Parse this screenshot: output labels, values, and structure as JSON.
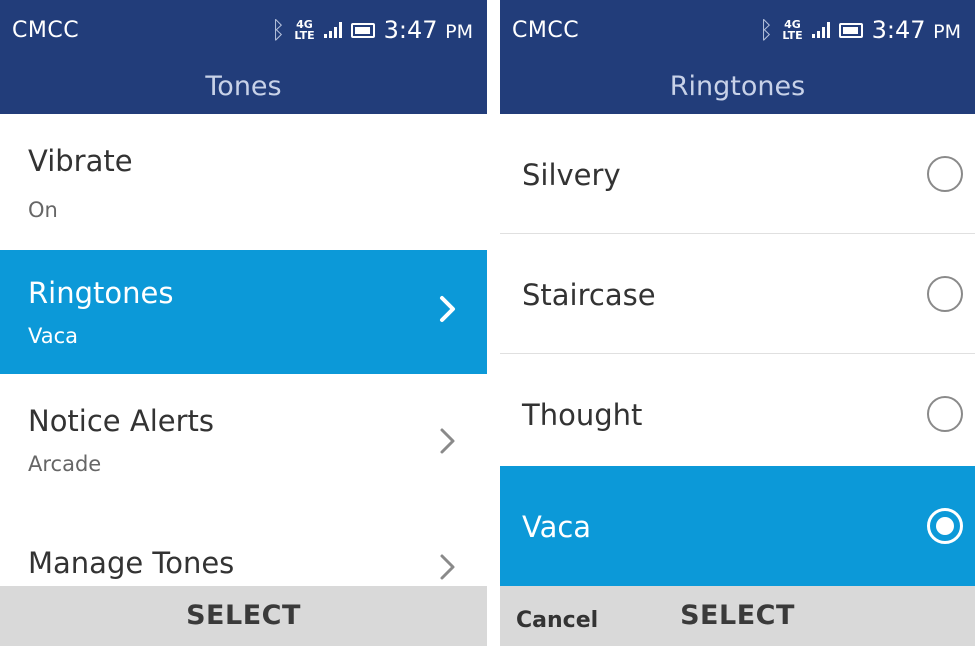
{
  "status": {
    "carrier": "CMCC",
    "network_top": "4G",
    "network_bottom": "LTE",
    "time": "3:47",
    "ampm": "PM"
  },
  "left": {
    "title": "Tones",
    "items": [
      {
        "title": "Vibrate",
        "value": "On"
      },
      {
        "title": "Ringtones",
        "value": "Vaca"
      },
      {
        "title": "Notice Alerts",
        "value": "Arcade"
      },
      {
        "title": "Manage Tones"
      }
    ],
    "softkey_center": "SELECT"
  },
  "right": {
    "title": "Ringtones",
    "options": [
      {
        "label": "Silvery"
      },
      {
        "label": "Staircase"
      },
      {
        "label": "Thought"
      },
      {
        "label": "Vaca"
      }
    ],
    "softkey_left": "Cancel",
    "softkey_center": "SELECT"
  },
  "colors": {
    "header": "#223d7a",
    "highlight": "#0c99d8",
    "softkey_bar": "#d9d9d9"
  }
}
